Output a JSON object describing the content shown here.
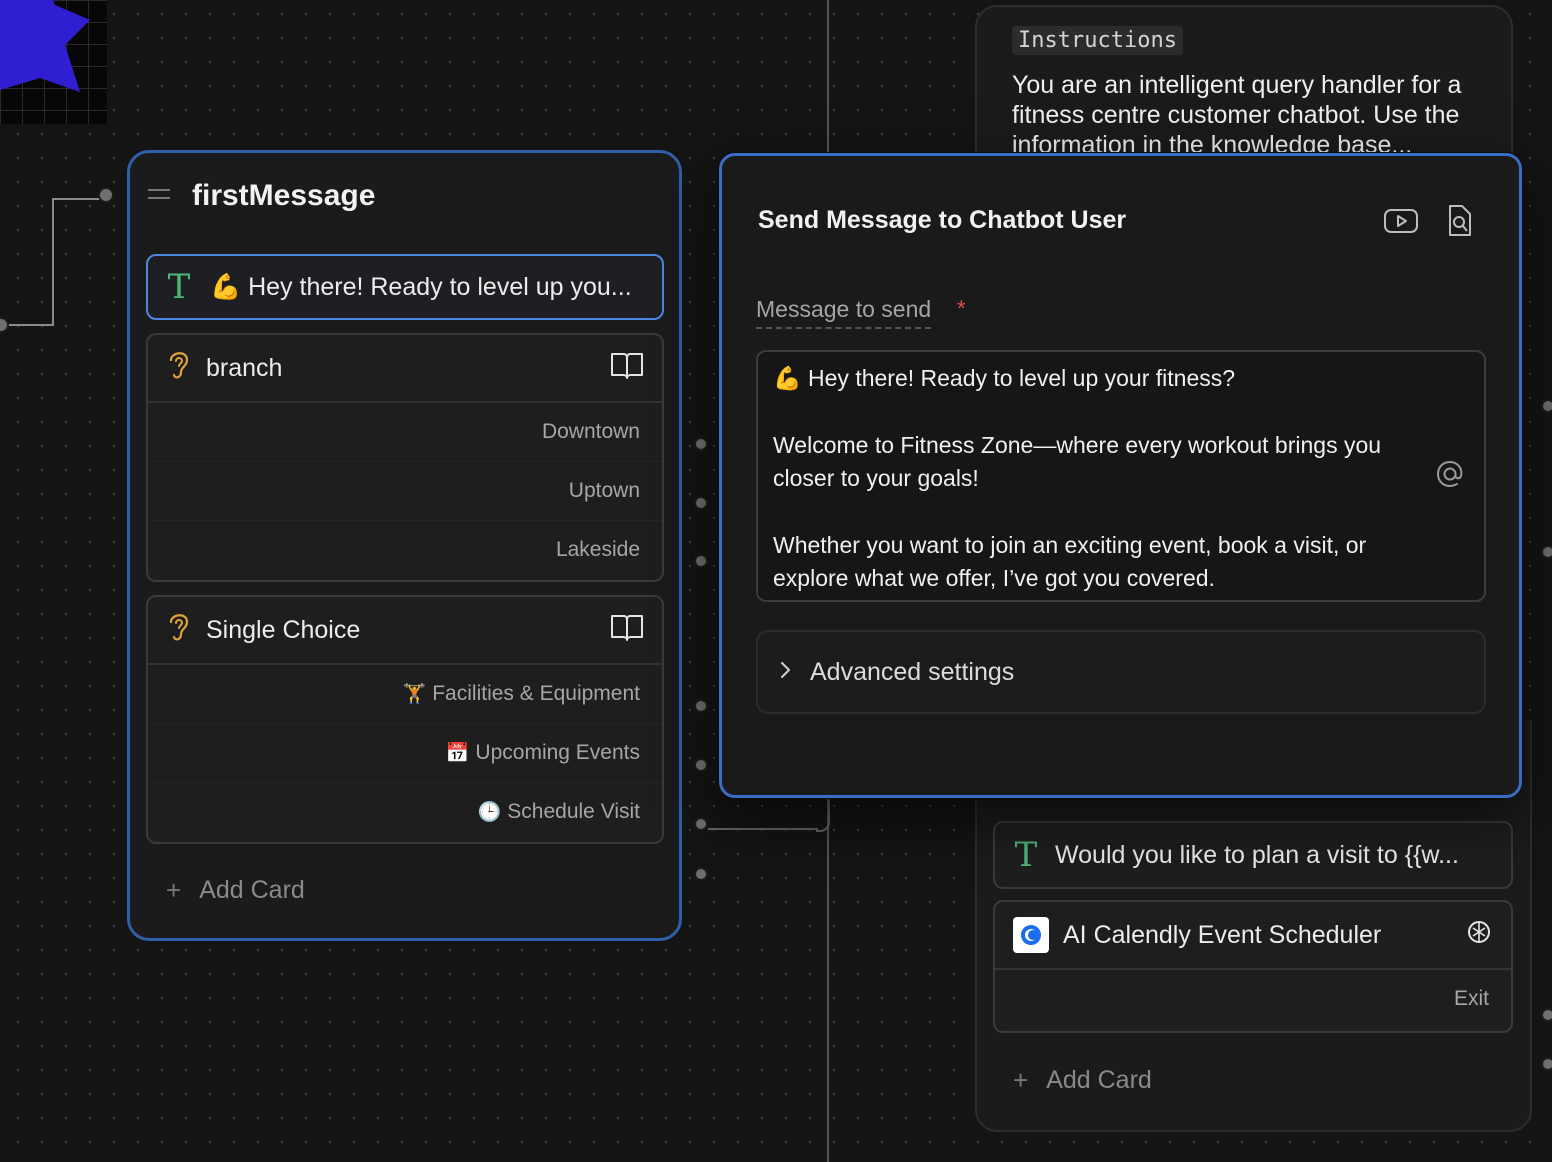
{
  "first_node": {
    "title": "firstMessage",
    "message_card": {
      "emoji": "💪",
      "text": "Hey there! Ready to level up you..."
    },
    "branch_card": {
      "title": "branch",
      "options": [
        "Downtown",
        "Uptown",
        "Lakeside"
      ]
    },
    "choice_card": {
      "title": "Single Choice",
      "options": [
        {
          "emoji": "🏋️",
          "label": "Facilities & Equipment"
        },
        {
          "emoji": "📅",
          "label": "Upcoming Events"
        },
        {
          "emoji": "🕒",
          "label": "Schedule Visit"
        }
      ]
    },
    "add_card": "Add Card"
  },
  "panel": {
    "title": "Send Message to Chatbot User",
    "field_label": "Message to send",
    "required_mark": "*",
    "message": {
      "emoji": "💪",
      "line1": "Hey there! Ready to level up your fitness?",
      "para2": "Welcome to Fitness Zone—where every workout brings you closer to your goals!",
      "para3": "Whether you want to join an exciting event, book a visit, or explore what we offer, I’ve got you covered."
    },
    "advanced": "Advanced settings",
    "icons": [
      "youtube-icon",
      "search-doc-icon",
      "at-icon"
    ]
  },
  "right_node": {
    "instructions_tag": "Instructions",
    "instructions_text": "You are an intelligent query handler for a fitness centre customer chatbot. Use the information in the knowledge base...",
    "message_card": "Would you like to plan a visit to {{w...",
    "calendly_card": {
      "title": "AI Calendly Event Scheduler",
      "options": [
        "Exit"
      ]
    },
    "add_card": "Add Card"
  },
  "colors": {
    "selection_border": "#3a6ec4",
    "text_icon": "#4fb57a",
    "ear_icon": "#e0a23a",
    "required": "#e05252"
  }
}
